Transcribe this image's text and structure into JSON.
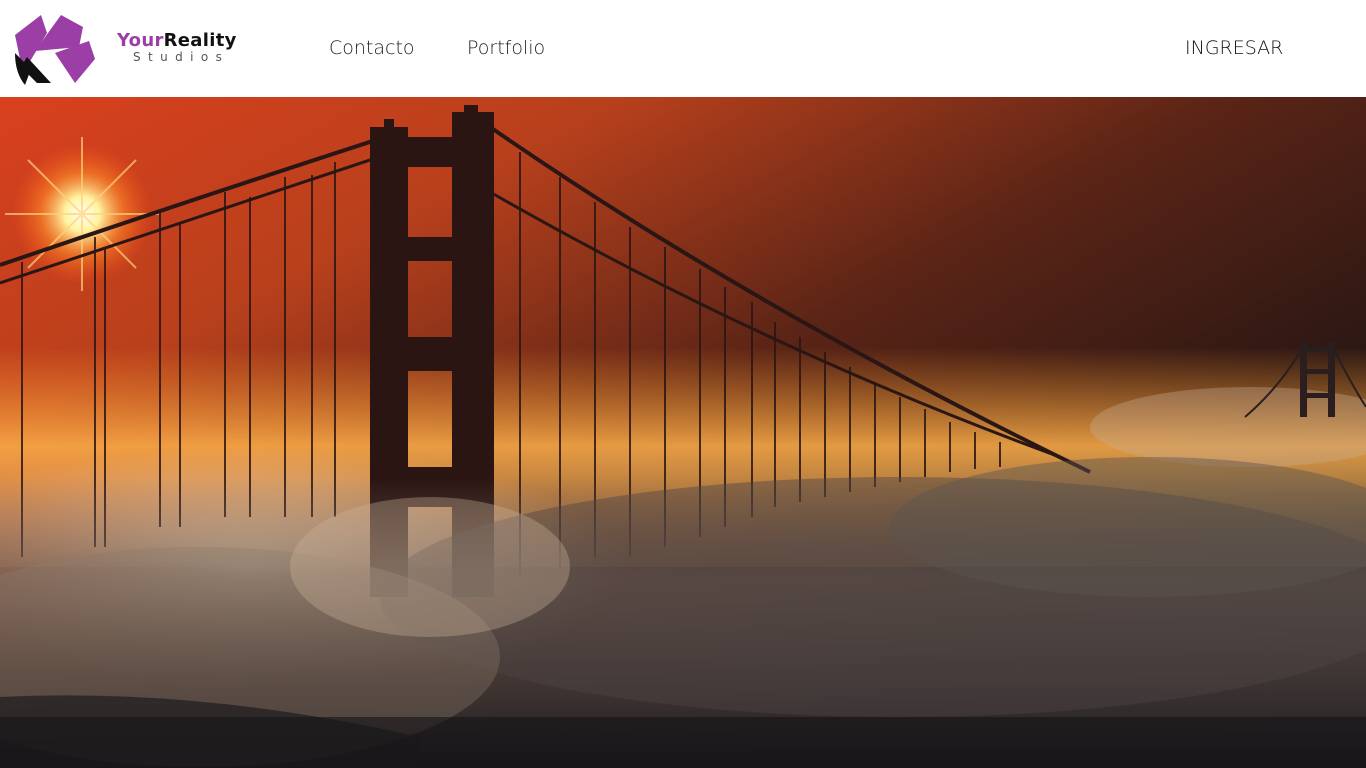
{
  "brand": {
    "name_part1": "Your",
    "name_part2": "Reality",
    "tagline": "Studios"
  },
  "nav": {
    "items": [
      {
        "label": "Contacto"
      },
      {
        "label": "Portfolio"
      }
    ],
    "login_label": "INGRESAR"
  },
  "colors": {
    "brand_purple": "#9b3fa6",
    "brand_dark": "#111111"
  },
  "hero": {
    "subject": "golden-gate-bridge-in-fog-at-sunset"
  }
}
